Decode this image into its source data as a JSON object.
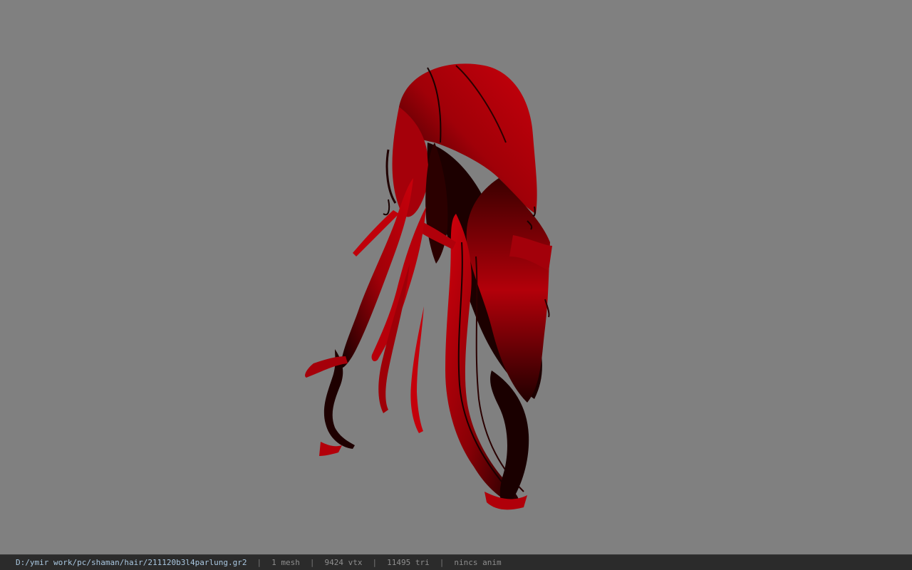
{
  "viewer": {
    "background_color": "#808080",
    "model_primary_color": "#c0000a",
    "model_shadow_color": "#1a0000"
  },
  "status_bar": {
    "file_path": "D:/ymir work/pc/shaman/hair/211120b3l4parlung.gr2",
    "separator": "|",
    "mesh_count": "1 mesh",
    "vertex_count": "9424 vtx",
    "triangle_count": "11495 tri",
    "anim_status": "nincs anim"
  }
}
